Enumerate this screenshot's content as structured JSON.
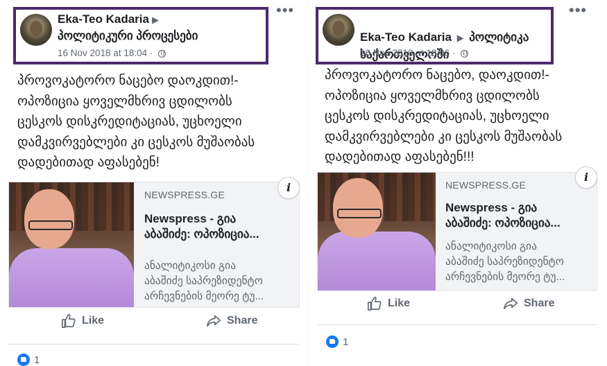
{
  "posts": [
    {
      "author": "Eka-Teo Kadaria",
      "group": "პოლიტიკური პროცესები",
      "timestamp": "16 Nov 2018 at 18:04",
      "more_icon": "more-icon",
      "text": "პროვოკატორო ნაცებო დაოკდით!-\nოპოზიცია ყოველმხრივ ცდილობს\nცესკოს დისკრედიტაციას, უცხოელი\nდამკვირვებლები კი ცესკოს მუშაობას\nდადებითად აფასებენ!",
      "link_card": {
        "domain": "NEWSPRESS.GE",
        "title": "Newspress - გია\nაბაშიძე: ოპოზიცია...",
        "description": "ანალიტიკოსი გია\nაბაშიძე საპრეზიდენტო\nარჩევნების მეორე ტუ...",
        "info": "i"
      },
      "actions": {
        "like": "Like",
        "share": "Share"
      },
      "reaction_count": "1"
    },
    {
      "author": "Eka-Teo Kadaria",
      "group": "პოლიტიკა\nსაქართველოში",
      "timestamp": "16 Nov 2018 at 18:06",
      "more_icon": "more-icon",
      "text": "პროვოკატორო ნაცებო, დაოკდით!-\nოპოზიცია ყოველმხრივ ცდილობს\nცესკოს დისკრედიტაციას, უცხოელი\nდამკვირვებლები კი ცესკოს მუშაობას\nდადებითად აფასებენ!!!",
      "link_card": {
        "domain": "NEWSPRESS.GE",
        "title": "Newspress - გია\nაბაშიძე: ოპოზიცია...",
        "description": "ანალიტიკოსი გია\nაბაშიძე საპრეზიდენტო\nარჩევნების მეორე ტუ...",
        "info": "i"
      },
      "actions": {
        "like": "Like",
        "share": "Share"
      },
      "reaction_count": "1"
    }
  ],
  "colors": {
    "highlight_border": "#4a2b6b",
    "like_blue": "#1877f2",
    "muted": "#606770"
  }
}
